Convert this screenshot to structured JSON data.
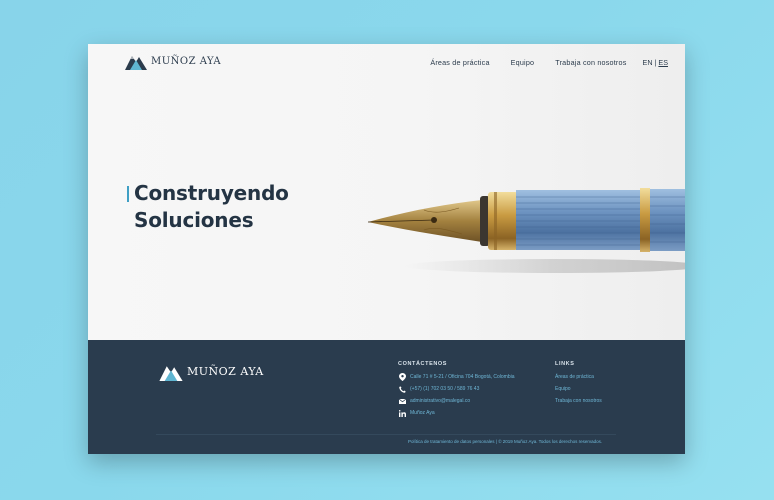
{
  "header": {
    "brand": "MUÑOZ AYA",
    "nav": [
      {
        "label": "Áreas de práctica"
      },
      {
        "label": "Equipo"
      },
      {
        "label": "Trabaja con nosotros"
      }
    ],
    "lang": {
      "en": "EN",
      "sep": "|",
      "es": "ES",
      "active": "ES"
    }
  },
  "hero": {
    "title_line1": "Construyendo",
    "title_line2": "Soluciones"
  },
  "footer": {
    "brand": "MUÑOZ AYA",
    "contact_title": "CONTÁCTENOS",
    "contact": {
      "address": "Calle 71 # 5-21 / Oficina 704 Bogotá, Colombia",
      "phone": "(+57) (1) 702 03 50 / 589 76 43",
      "email": "administrativo@malegal.co",
      "linkedin": "Muñoz Aya"
    },
    "links_title": "LINKS",
    "links": [
      {
        "label": "Áreas de práctica"
      },
      {
        "label": "Equipo"
      },
      {
        "label": "Trabaja con nosotros"
      }
    ],
    "bottom_text": "Política de tratamiento de datos personales  |  © 2019 Muñoz Aya. Todos los derechos reservados."
  },
  "colors": {
    "background": "#8ad8ec",
    "navy": "#2a3c4e",
    "accent": "#3f9fc4",
    "link": "#6fb7d6"
  }
}
